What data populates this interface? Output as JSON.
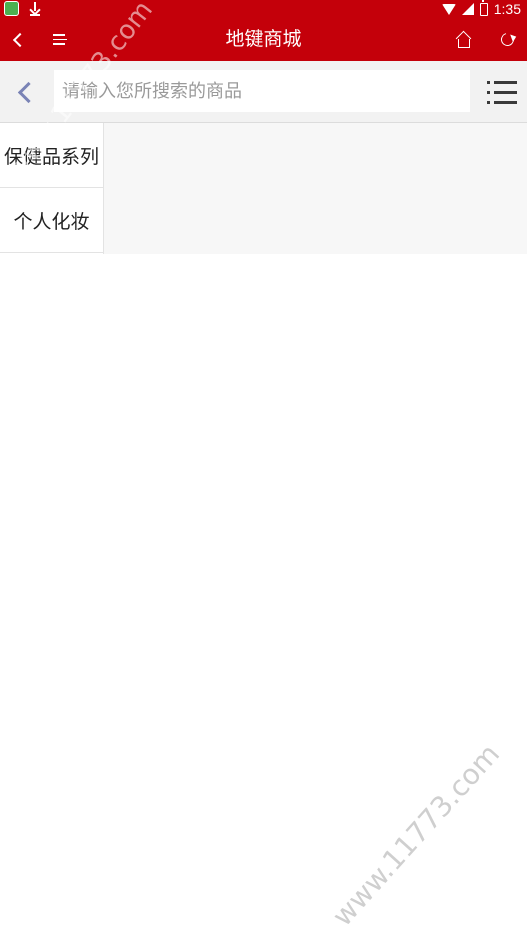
{
  "status_bar": {
    "time": "1:35",
    "icons": [
      "app-notification-icon",
      "download-icon",
      "wifi-icon",
      "signal-icon",
      "battery-icon"
    ]
  },
  "header": {
    "title": "地键商城",
    "background_color": "#c4000a",
    "left_icons": [
      "back-icon",
      "menu-icon"
    ],
    "right_icons": [
      "home-icon",
      "refresh-icon"
    ]
  },
  "search": {
    "placeholder": "请输入您所搜索的商品",
    "value": "",
    "back_icon": "chevron-left-icon",
    "menu_icon": "list-menu-icon"
  },
  "categories": [
    {
      "label": "保健品系列"
    },
    {
      "label": "个人化妆"
    }
  ],
  "watermark": {
    "text": "www.11773.com"
  }
}
